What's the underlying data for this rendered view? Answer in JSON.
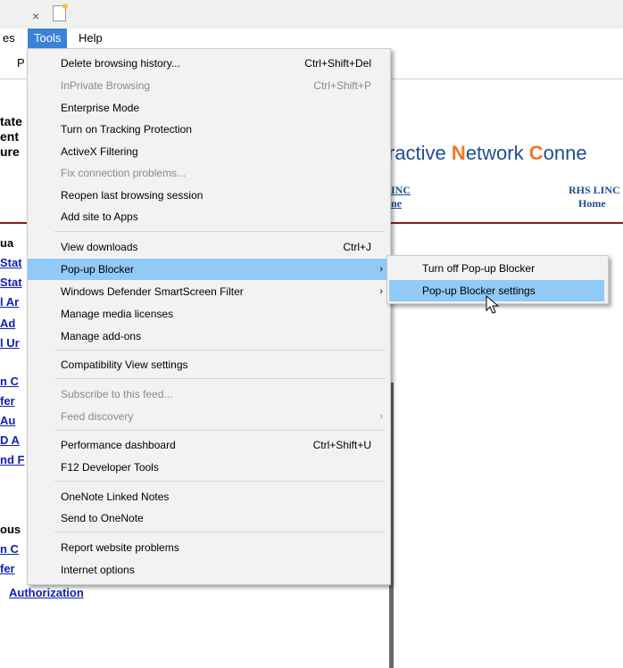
{
  "browser": {
    "tab_close_glyph": "×",
    "menubar": {
      "files": "es",
      "tools": "Tools",
      "help": "Help"
    },
    "favbar_text": "P"
  },
  "page": {
    "header_fragments": [
      "tate",
      "ent",
      "ure"
    ],
    "inc_title": {
      "a": "ractive ",
      "n": "N",
      "b": "etwork ",
      "c": "C",
      "d": "onne"
    },
    "links": [
      {
        "line1": "INC",
        "line2": "ne"
      },
      {
        "line1": "RHS LINC",
        "line2": "Home"
      }
    ],
    "left_fragments": [
      {
        "text": "ua",
        "link": false
      },
      {
        "text": "Stat",
        "link": true
      },
      {
        "text": "Stat",
        "link": true
      },
      {
        "text": "l Ar",
        "link": true
      },
      {
        "text": " Ad",
        "link": true
      },
      {
        "text": "l Ur",
        "link": true
      },
      {
        "text": "n C",
        "link": true
      },
      {
        "text": "fer",
        "link": true
      },
      {
        "text": " Au",
        "link": true
      },
      {
        "text": "D A",
        "link": true
      },
      {
        "text": "nd F",
        "link": true
      },
      {
        "text": "ous",
        "link": false
      },
      {
        "text": "n C",
        "link": true
      },
      {
        "text": "fer",
        "link": true
      }
    ],
    "authorization_link": "Authorization"
  },
  "tools_menu": {
    "items": [
      {
        "label": "Delete browsing history...",
        "shortcut": "Ctrl+Shift+Del",
        "disabled": false
      },
      {
        "label": "InPrivate Browsing",
        "shortcut": "Ctrl+Shift+P",
        "disabled": true
      },
      {
        "label": "Enterprise Mode",
        "shortcut": "",
        "disabled": false
      },
      {
        "label": "Turn on Tracking Protection",
        "shortcut": "",
        "disabled": false
      },
      {
        "label": "ActiveX Filtering",
        "shortcut": "",
        "disabled": false
      },
      {
        "label": "Fix connection problems...",
        "shortcut": "",
        "disabled": true
      },
      {
        "label": "Reopen last browsing session",
        "shortcut": "",
        "disabled": false
      },
      {
        "label": "Add site to Apps",
        "shortcut": "",
        "disabled": false
      },
      {
        "label": "View downloads",
        "shortcut": "Ctrl+J",
        "disabled": false
      },
      {
        "label": "Pop-up Blocker",
        "shortcut": "",
        "disabled": false,
        "submenu": true,
        "highlighted": true
      },
      {
        "label": "Windows Defender SmartScreen Filter",
        "shortcut": "",
        "disabled": false,
        "submenu": true
      },
      {
        "label": "Manage media licenses",
        "shortcut": "",
        "disabled": false
      },
      {
        "label": "Manage add-ons",
        "shortcut": "",
        "disabled": false
      },
      {
        "label": "Compatibility View settings",
        "shortcut": "",
        "disabled": false
      },
      {
        "label": "Subscribe to this feed...",
        "shortcut": "",
        "disabled": true
      },
      {
        "label": "Feed discovery",
        "shortcut": "",
        "disabled": true,
        "submenu": true
      },
      {
        "label": "Performance dashboard",
        "shortcut": "Ctrl+Shift+U",
        "disabled": false
      },
      {
        "label": "F12 Developer Tools",
        "shortcut": "",
        "disabled": false
      },
      {
        "label": "OneNote Linked Notes",
        "shortcut": "",
        "disabled": false
      },
      {
        "label": "Send to OneNote",
        "shortcut": "",
        "disabled": false
      },
      {
        "label": "Report website problems",
        "shortcut": "",
        "disabled": false
      },
      {
        "label": "Internet options",
        "shortcut": "",
        "disabled": false
      }
    ],
    "arrow_glyph": "›"
  },
  "popup_submenu": {
    "items": [
      {
        "label": "Turn off Pop-up Blocker",
        "highlighted": false
      },
      {
        "label": "Pop-up Blocker settings",
        "highlighted": true
      }
    ]
  },
  "colors": {
    "menu_highlight": "#91c9f7",
    "tools_active": "#3a82d6",
    "link": "#1020b0",
    "accent_orange": "#f07820"
  }
}
